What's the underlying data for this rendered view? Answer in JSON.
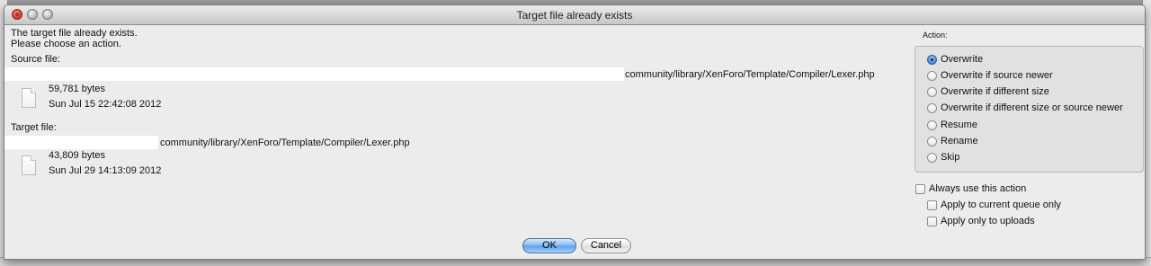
{
  "window": {
    "title": "Target file already exists"
  },
  "message": {
    "line1": "The target file already exists.",
    "line2": "Please choose an action."
  },
  "source": {
    "label": "Source file:",
    "path": "community/library/XenForo/Template/Compiler/Lexer.php",
    "size": "59,781 bytes",
    "modified": "Sun Jul 15 22:42:08 2012"
  },
  "target": {
    "label": "Target file:",
    "path": "community/library/XenForo/Template/Compiler/Lexer.php",
    "size": "43,809 bytes",
    "modified": "Sun Jul 29 14:13:09 2012"
  },
  "action_group": {
    "label": "Action:",
    "options": [
      {
        "label": "Overwrite",
        "selected": true
      },
      {
        "label": "Overwrite if source newer",
        "selected": false
      },
      {
        "label": "Overwrite if different size",
        "selected": false
      },
      {
        "label": "Overwrite if different size or source newer",
        "selected": false
      },
      {
        "label": "Resume",
        "selected": false
      },
      {
        "label": "Rename",
        "selected": false
      },
      {
        "label": "Skip",
        "selected": false
      }
    ]
  },
  "options": {
    "always_use": "Always use this action",
    "apply_queue": "Apply to current queue only",
    "apply_uploads": "Apply only to uploads"
  },
  "buttons": {
    "ok": "OK",
    "cancel": "Cancel"
  },
  "colors": {
    "dialog_bg": "#ececec",
    "default_button": "#7fb5ef",
    "selected_radio": "#4b96e6"
  }
}
